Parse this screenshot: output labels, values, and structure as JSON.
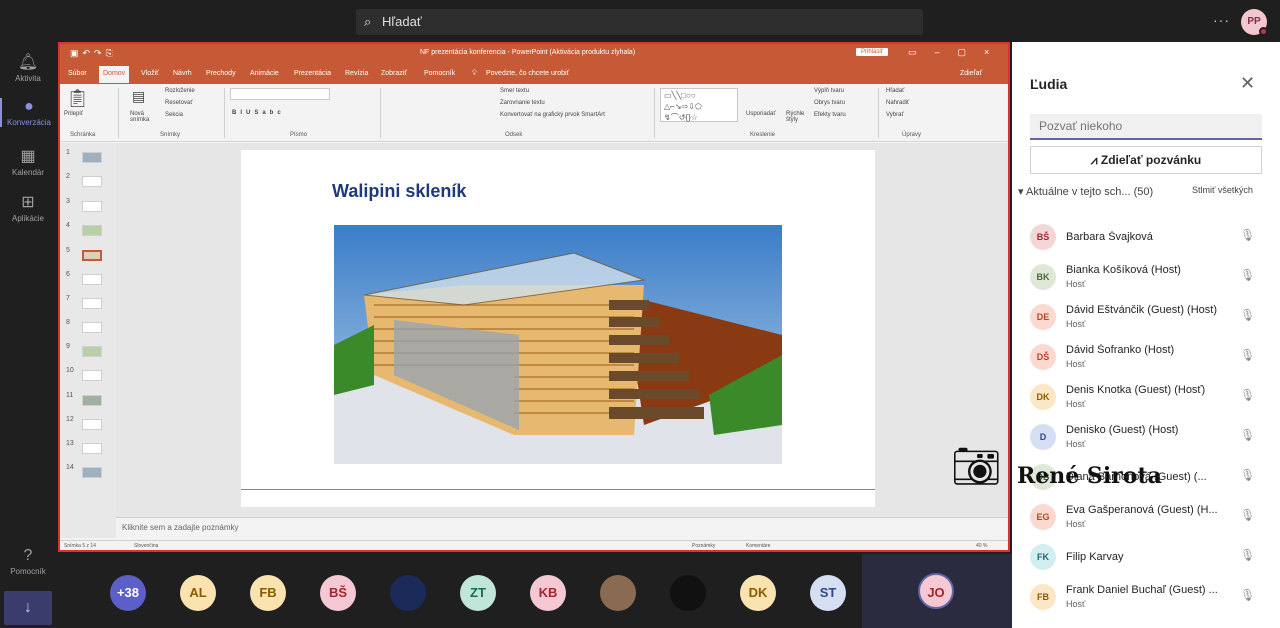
{
  "topbar": {
    "search_placeholder": "Hľadať",
    "more": "···",
    "user_initials": "PP"
  },
  "rail": [
    {
      "label": "Aktivita",
      "icon": "bell-icon"
    },
    {
      "label": "Konverzácia",
      "icon": "chat-icon"
    },
    {
      "label": "Kalendár",
      "icon": "calendar-icon"
    },
    {
      "label": "Aplikácie",
      "icon": "apps-icon"
    },
    {
      "label": "Pomocník",
      "icon": "help-icon"
    }
  ],
  "ppt": {
    "title": "NF prezentácia konferencia  -  PowerPoint (Aktivácia produktu zlyhala)",
    "sign_in": "Prihlásiť",
    "tabs": [
      "Súbor",
      "Domov",
      "Vložiť",
      "Návrh",
      "Prechody",
      "Animácie",
      "Prezentácia",
      "Revízia",
      "Zobraziť",
      "Pomocník"
    ],
    "tell_me": "Povedzte, čo chcete urobiť",
    "share": "Zdieľať",
    "ribbon": {
      "paste": "Prilepiť",
      "new_slide": "Nová snímka",
      "layout": "Rozloženie",
      "reset": "Resetovať",
      "section": "Sekcia",
      "text_dir": "Smer textu",
      "align_text": "Zarovnanie textu",
      "smartart": "Konvertovať na grafický prvok SmartArt",
      "arrange": "Usporiadať",
      "quick_styles": "Rýchle štýly",
      "fill": "Výplň tvaru",
      "outline": "Obrys tvaru",
      "effects": "Efekty tvaru",
      "find": "Hľadať",
      "replace": "Nahradiť",
      "select": "Vybrať",
      "groups": [
        "Schránka",
        "Snímky",
        "Písmo",
        "Odsek",
        "Kreslenie",
        "Úpravy"
      ]
    },
    "slide_numbers": [
      "1",
      "2",
      "3",
      "4",
      "5",
      "6",
      "7",
      "8",
      "9",
      "10",
      "11",
      "12",
      "13",
      "14"
    ],
    "selected_slide": 5,
    "slide_title": "Walipini skleník",
    "notes_placeholder": "Kliknite sem a zadajte poznámky",
    "status": {
      "slide_of": "Snímka 5 z 14",
      "language": "Slovenčina",
      "notes": "Poznámky",
      "comments": "Komentáre",
      "zoom": "40 %"
    }
  },
  "panel": {
    "title": "Ľudia",
    "invite_placeholder": "Pozvať niekoho",
    "share_invite": "Zdieľať pozvánku",
    "section": "Aktuálne v tejto sch...",
    "count": "(50)",
    "mute_all": "Stlmiť všetkých",
    "people": [
      {
        "initials": "BŠ",
        "name": "Barbara Švajková",
        "role": "",
        "bg": "#f3d6d8",
        "fg": "#a4262c"
      },
      {
        "initials": "BK",
        "name": "Bianka Košíková (Host)",
        "role": "Hosť",
        "bg": "#dfe7d8",
        "fg": "#4a6a3a"
      },
      {
        "initials": "DE",
        "name": "Dávid Eštvánčik (Guest) (Host)",
        "role": "Hosť",
        "bg": "#fbd9cf",
        "fg": "#b5432c"
      },
      {
        "initials": "DŠ",
        "name": "Dávid Šofranko (Host)",
        "role": "Hosť",
        "bg": "#fbd9cf",
        "fg": "#b5432c"
      },
      {
        "initials": "DK",
        "name": "Denis Knotka (Guest) (Hosť)",
        "role": "Hosť",
        "bg": "#fbe7c6",
        "fg": "#8a5a00"
      },
      {
        "initials": "D",
        "name": "Denisko (Guest) (Host)",
        "role": "Hosť",
        "bg": "#d6def3",
        "fg": "#2a4a8a"
      },
      {
        "initials": "DB",
        "name": "Diana Barňoňová (Guest) (...",
        "role": "",
        "bg": "#dfe7d8",
        "fg": "#4a6a3a"
      },
      {
        "initials": "EG",
        "name": "Eva Gašperanová (Guest) (H...",
        "role": "Hosť",
        "bg": "#fbd9cf",
        "fg": "#b5432c"
      },
      {
        "initials": "FK",
        "name": "Filip Karvay",
        "role": "",
        "bg": "#d3eef0",
        "fg": "#1a6a70"
      },
      {
        "initials": "FB",
        "name": "Frank Daniel Buchaľ (Guest) ...",
        "role": "Hosť",
        "bg": "#fbe7c6",
        "fg": "#8a5a00"
      }
    ]
  },
  "strip": {
    "participants": [
      {
        "label": "+38",
        "bg": "#5b5fc7",
        "fg": "#ffffff"
      },
      {
        "label": "AL",
        "bg": "#fbe3b0",
        "fg": "#8a5a00"
      },
      {
        "label": "FB",
        "bg": "#fbe3b0",
        "fg": "#8a5a00"
      },
      {
        "label": "BŠ",
        "bg": "#f4c9d3",
        "fg": "#a4262c"
      },
      {
        "label": "",
        "bg": "#1c2a5a",
        "fg": "#ffffff"
      },
      {
        "label": "ZT",
        "bg": "#bfe6d9",
        "fg": "#1a6a50"
      },
      {
        "label": "KB",
        "bg": "#f4c9d3",
        "fg": "#a4262c"
      },
      {
        "label": "",
        "bg": "#8a6a50",
        "fg": "#ffffff"
      },
      {
        "label": "",
        "bg": "#111111",
        "fg": "#ffffff"
      },
      {
        "label": "DK",
        "bg": "#fbe3b0",
        "fg": "#8a5a00"
      },
      {
        "label": "ST",
        "bg": "#d6def3",
        "fg": "#2a4a8a"
      }
    ],
    "self": {
      "label": "JO",
      "bg": "#f4c9d3",
      "fg": "#a4262c"
    }
  },
  "overlay": {
    "name": "René Sirota"
  }
}
